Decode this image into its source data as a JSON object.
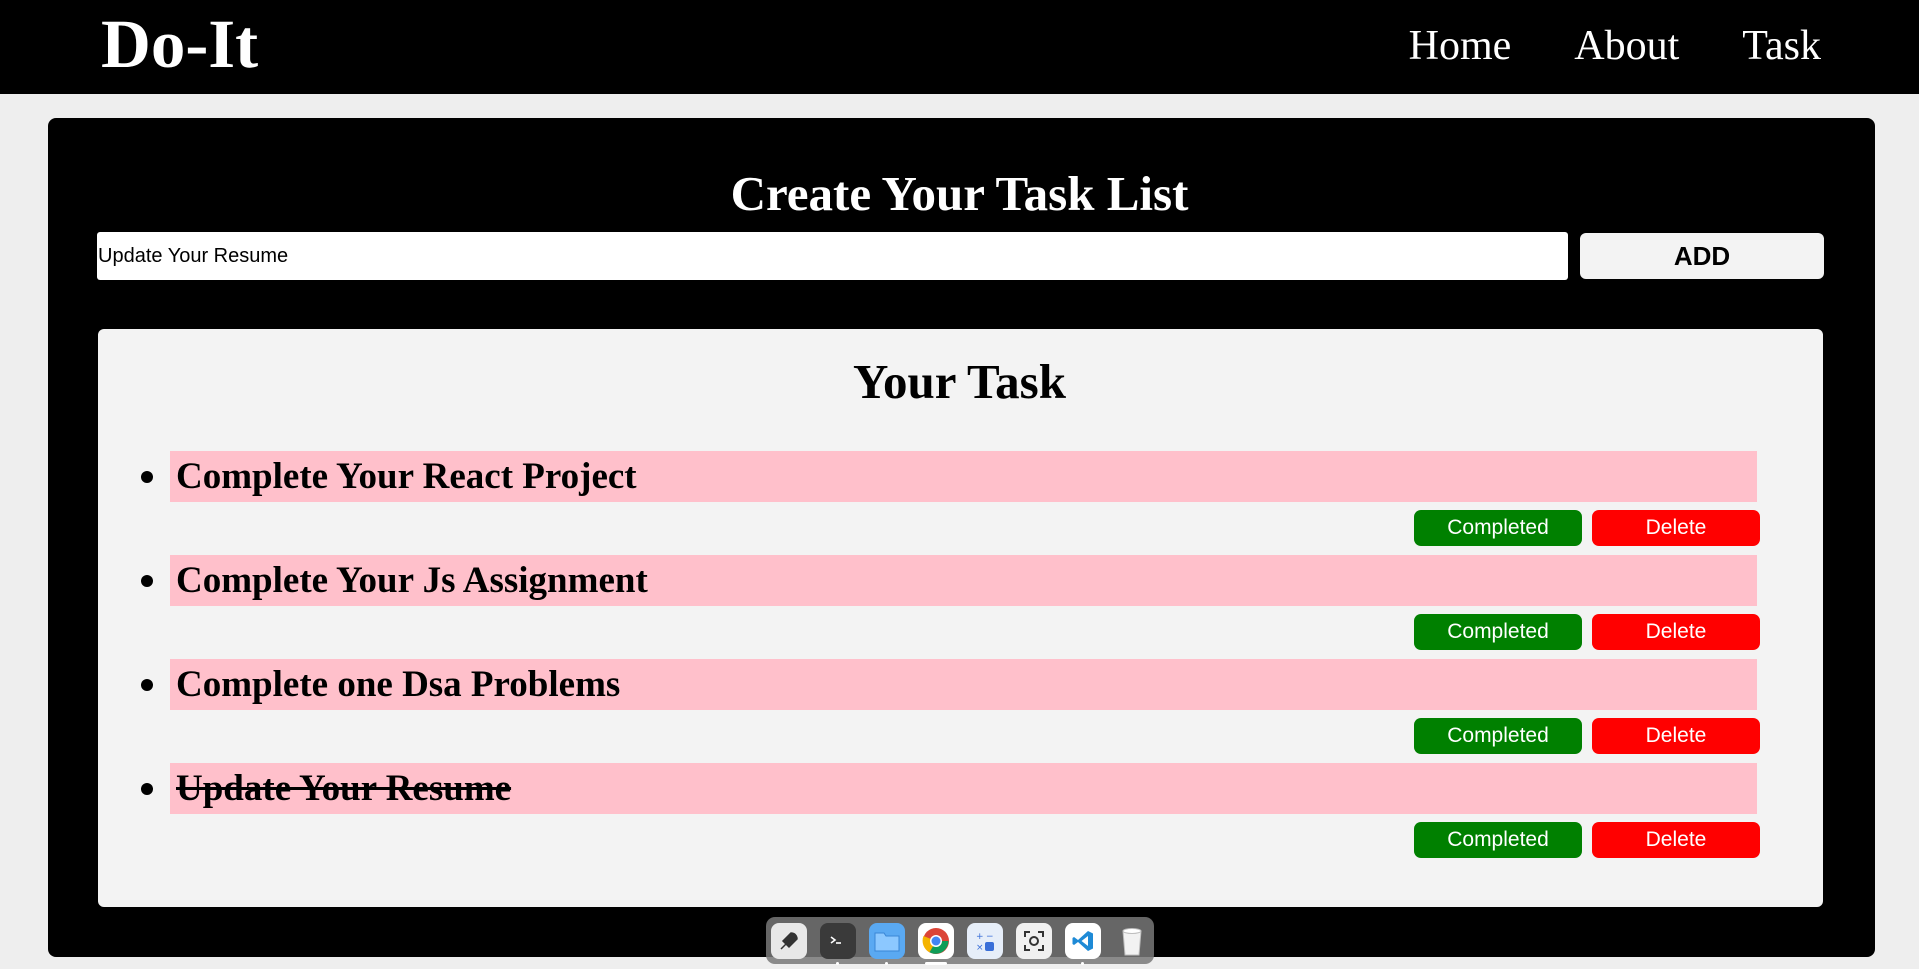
{
  "app": {
    "brand": "Do-It"
  },
  "nav": {
    "items": [
      {
        "label": "Home"
      },
      {
        "label": "About"
      },
      {
        "label": "Task"
      }
    ]
  },
  "create": {
    "title": "Create Your Task List",
    "input_value": "Update Your Resume",
    "add_label": "ADD"
  },
  "tasks_panel": {
    "title": "Your Task",
    "completed_label": "Completed",
    "delete_label": "Delete",
    "items": [
      {
        "text": "Complete Your React Project",
        "done": false
      },
      {
        "text": "Complete Your Js Assignment",
        "done": false
      },
      {
        "text": "Complete one Dsa Problems",
        "done": false
      },
      {
        "text": "Update Your Resume",
        "done": true
      }
    ]
  },
  "colors": {
    "navbar": "#000000",
    "task_bar": "#ffc0cb",
    "completed_button": "#008000",
    "delete_button": "#ff0000"
  },
  "dock": {
    "icons": [
      "launcher-icon",
      "terminal-icon",
      "files-icon",
      "chrome-icon",
      "calculator-icon",
      "screenshot-icon",
      "vscode-icon",
      "trash-icon"
    ]
  }
}
